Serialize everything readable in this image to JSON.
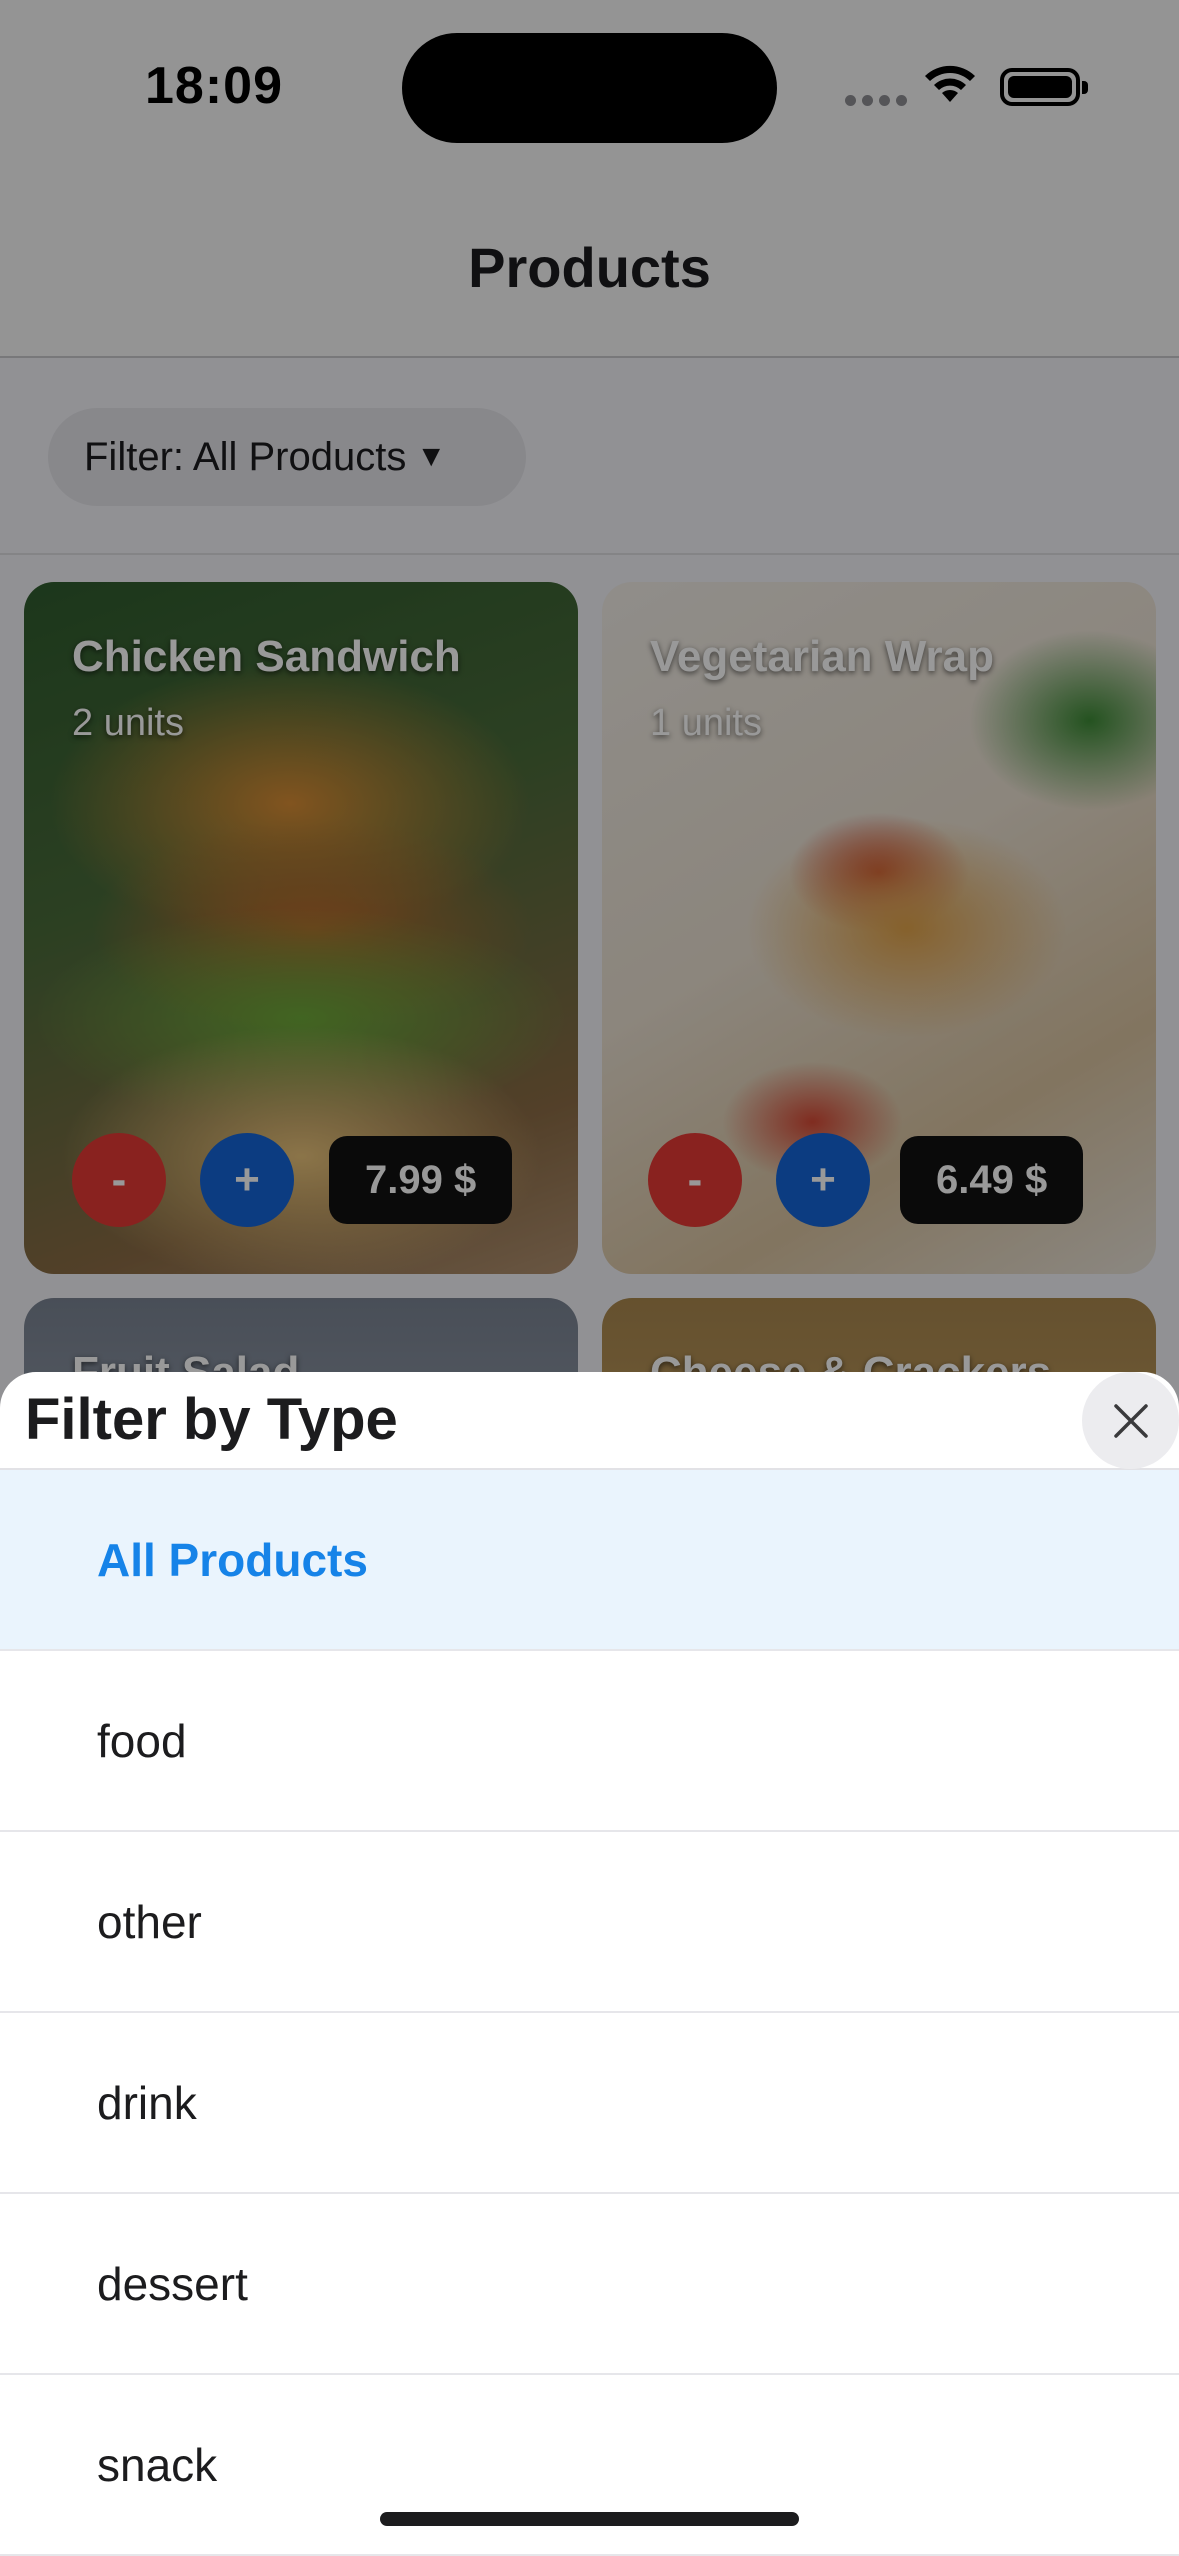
{
  "status_bar": {
    "time": "18:09"
  },
  "header": {
    "title": "Products"
  },
  "filter": {
    "label": "Filter: All Products",
    "caret": "▼"
  },
  "products": [
    {
      "name": "Chicken Sandwich",
      "units": "2 units",
      "price": "7.99 $",
      "minus": "-",
      "plus": "+"
    },
    {
      "name": "Vegetarian Wrap",
      "units": "1 units",
      "price": "6.49 $",
      "minus": "-",
      "plus": "+"
    },
    {
      "name": "Fruit Salad"
    },
    {
      "name": "Cheese & Crackers"
    }
  ],
  "sheet": {
    "title": "Filter by Type",
    "options": [
      "All Products",
      "food",
      "other",
      "drink",
      "dessert",
      "snack"
    ],
    "selected": "All Products"
  },
  "colors": {
    "accent": "#1683e8",
    "minus": "#e53935",
    "plus": "#1565d8",
    "price_bg": "#111111"
  },
  "icons": [
    "wifi-icon",
    "battery-icon",
    "close-icon"
  ]
}
